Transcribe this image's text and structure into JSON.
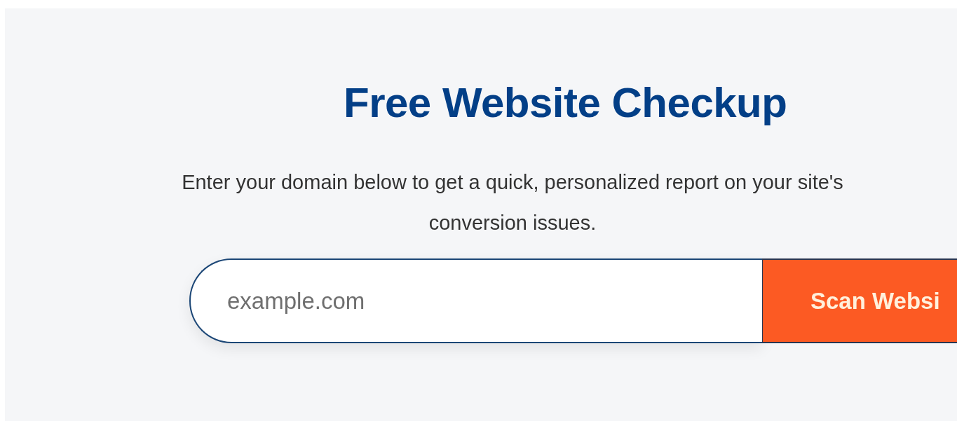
{
  "title": "Free Website Checkup",
  "description": "Enter your domain below to get a quick, personalized report on your site's\nconversion issues.",
  "form": {
    "placeholder": "example.com",
    "button": "Scan Websi"
  }
}
